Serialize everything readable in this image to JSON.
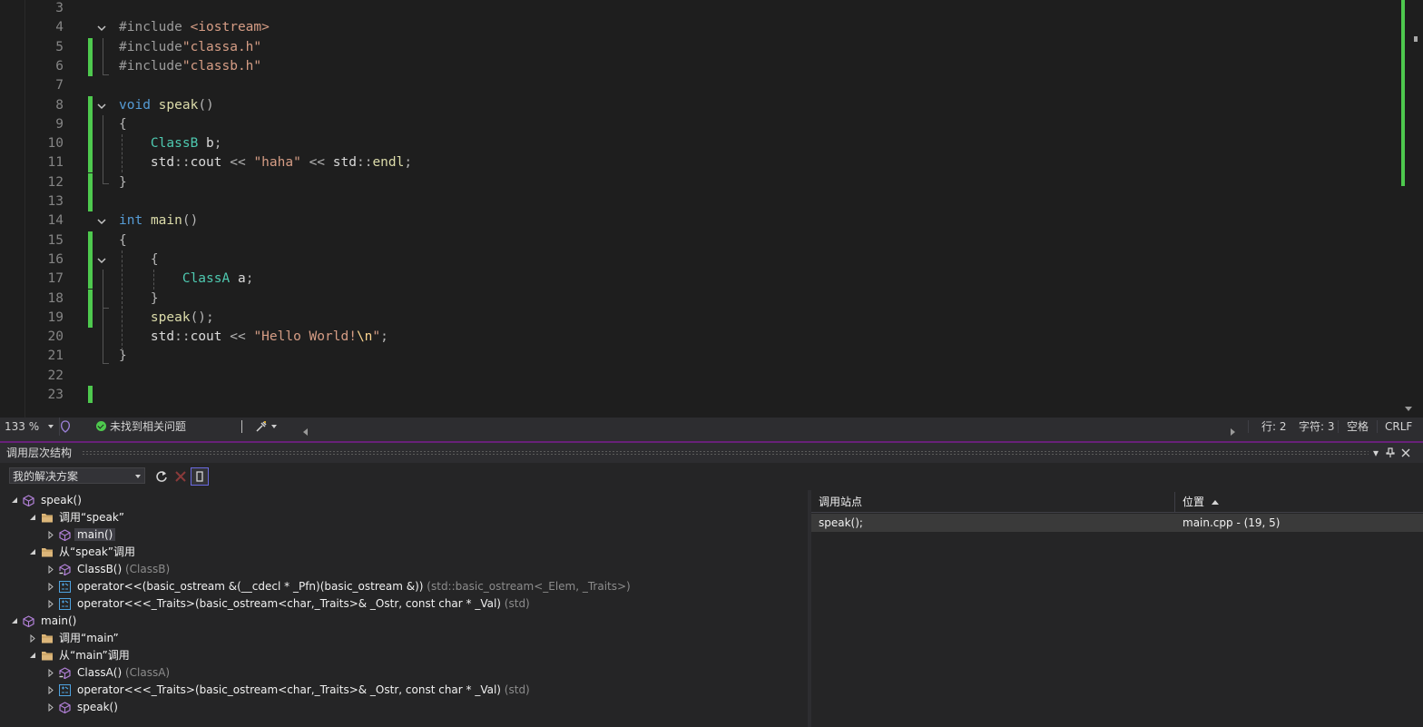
{
  "editor": {
    "lines": [
      {
        "n": "3",
        "html": ""
      },
      {
        "n": "4",
        "html": "<span class='pp'>#include</span> <span class='str'>&lt;iostream&gt;</span>"
      },
      {
        "n": "5",
        "html": "<span class='pp'>#include</span><span class='str'>\"classa.h\"</span>"
      },
      {
        "n": "6",
        "html": "<span class='pp'>#include</span><span class='str'>\"classb.h\"</span>"
      },
      {
        "n": "7",
        "html": ""
      },
      {
        "n": "8",
        "html": "<span class='kw'>void</span> <span class='fn'>speak</span><span class='op'>()</span>"
      },
      {
        "n": "9",
        "html": "<span class='op'>{</span>"
      },
      {
        "n": "10",
        "html": "    <span class='ty'>ClassB</span> <span class='id'>b</span><span class='op'>;</span>"
      },
      {
        "n": "11",
        "html": "    <span class='id'>std</span><span class='op'>::</span><span class='id'>cout</span> <span class='op'>&lt;&lt;</span> <span class='str'>\"haha\"</span> <span class='op'>&lt;&lt;</span> <span class='id'>std</span><span class='op'>::</span><span class='fn'>endl</span><span class='op'>;</span>"
      },
      {
        "n": "12",
        "html": "<span class='op'>}</span>"
      },
      {
        "n": "13",
        "html": ""
      },
      {
        "n": "14",
        "html": "<span class='kw'>int</span> <span class='fn'>main</span><span class='op'>()</span>"
      },
      {
        "n": "15",
        "html": "<span class='op'>{</span>"
      },
      {
        "n": "16",
        "html": "    <span class='op'>{</span>"
      },
      {
        "n": "17",
        "html": "        <span class='ty'>ClassA</span> <span class='id'>a</span><span class='op'>;</span>"
      },
      {
        "n": "18",
        "html": "    <span class='op'>}</span>"
      },
      {
        "n": "19",
        "html": "    <span class='fn'>speak</span><span class='op'>();</span>"
      },
      {
        "n": "20",
        "html": "    <span class='id'>std</span><span class='op'>::</span><span class='id'>cout</span> <span class='op'>&lt;&lt;</span> <span class='str'>\"Hello World!</span><span class='esc'>\\n</span><span class='str'>\"</span><span class='op'>;</span>"
      },
      {
        "n": "21",
        "html": "<span class='op'>}</span>"
      },
      {
        "n": "22",
        "html": ""
      },
      {
        "n": "23",
        "html": ""
      }
    ]
  },
  "status": {
    "zoom": "133 %",
    "issues": "未找到相关问题",
    "line": "行: 2",
    "char": "字符: 3",
    "whitespace": "空格",
    "eol": "CRLF"
  },
  "panel": {
    "title": "调用层次结构",
    "scope": "我的解决方案",
    "tree": [
      {
        "label": "speak()",
        "suffix": ""
      },
      {
        "label": "调用“speak”",
        "suffix": ""
      },
      {
        "label": "main()",
        "suffix": ""
      },
      {
        "label": "从“speak”调用",
        "suffix": ""
      },
      {
        "label": "ClassB()",
        "suffix": "(ClassB)"
      },
      {
        "label": "operator<<(basic_ostream &(__cdecl * _Pfn)(basic_ostream &))",
        "suffix": "(std::basic_ostream<_Elem, _Traits>)"
      },
      {
        "label": "operator<<<_Traits>(basic_ostream<char,_Traits>& _Ostr, const char * _Val)",
        "suffix": "(std)"
      },
      {
        "label": "main()",
        "suffix": ""
      },
      {
        "label": "调用“main”",
        "suffix": ""
      },
      {
        "label": "从“main”调用",
        "suffix": ""
      },
      {
        "label": "ClassA()",
        "suffix": "(ClassA)"
      },
      {
        "label": "operator<<<_Traits>(basic_ostream<char,_Traits>& _Ostr, const char * _Val)",
        "suffix": "(std)"
      },
      {
        "label": "speak()",
        "suffix": ""
      }
    ],
    "details": {
      "col_callsite": "调用站点",
      "col_location": "位置",
      "row_callsite": "speak();",
      "row_location": "main.cpp - (19, 5)"
    }
  },
  "colors": {
    "accent": "#68217a",
    "change_bar": "#4ec94e"
  }
}
